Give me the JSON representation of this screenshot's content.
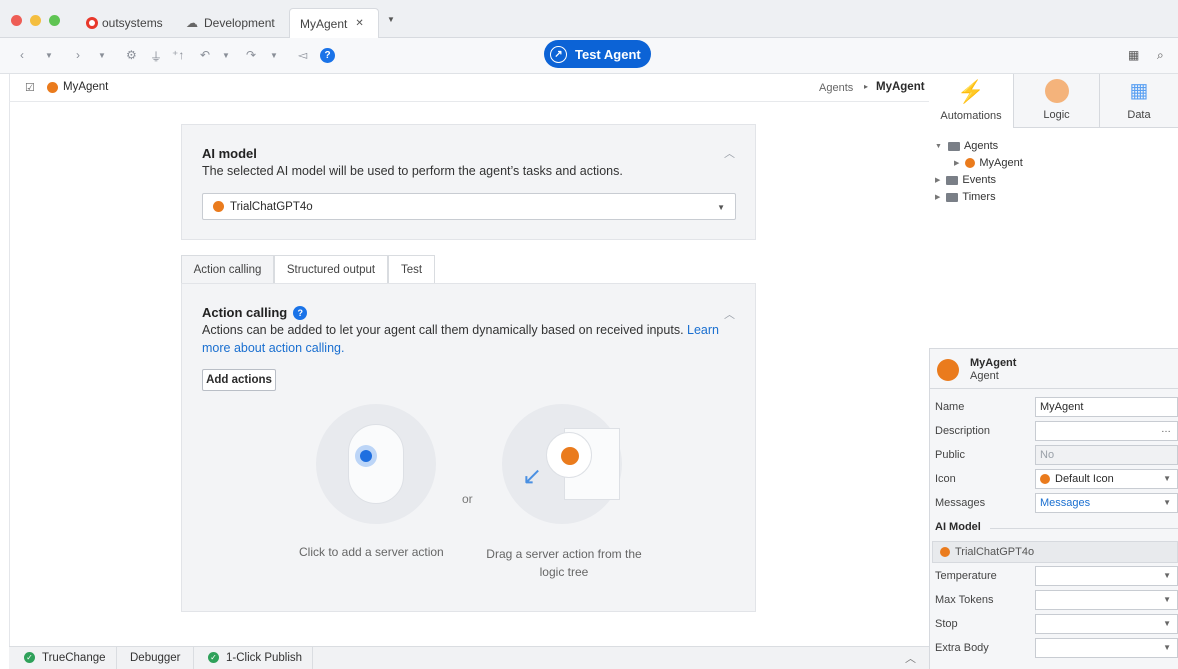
{
  "window": {
    "brand": "outsystems",
    "tabs": [
      {
        "label": "Development"
      },
      {
        "label": "MyAgent",
        "close": "✕"
      }
    ]
  },
  "toolbar": {
    "test_agent_label": "Test Agent"
  },
  "breadcrumb": {
    "element_name": "MyAgent",
    "path_parent": "Agents",
    "path_separator": "▸",
    "path_current": "MyAgent"
  },
  "ai_model_card": {
    "title": "AI model",
    "description": "The selected AI model will be used to perform the agent’s tasks and actions.",
    "selected_model": "TrialChatGPT4o"
  },
  "subtabs": [
    "Action calling",
    "Structured output",
    "Test"
  ],
  "action_calling": {
    "title": "Action calling",
    "description_part1": "Actions can be added to let your agent call them dynamically based on received inputs. ",
    "learn_more_link": "Learn more about action calling.",
    "add_button": "Add actions",
    "or_text": "or",
    "option1": "Click to add a server action",
    "option2": "Drag a server action from the logic tree"
  },
  "right_tabs": [
    {
      "label": "Automations",
      "icon": "lightning-icon"
    },
    {
      "label": "Logic",
      "icon": "logic-icon"
    },
    {
      "label": "Data",
      "icon": "data-grid-icon"
    }
  ],
  "tree": [
    {
      "label": "Agents"
    },
    {
      "label": "MyAgent"
    },
    {
      "label": "Events"
    },
    {
      "label": "Timers"
    }
  ],
  "properties": {
    "header_name": "MyAgent",
    "header_type": "Agent",
    "rows": [
      {
        "label": "Name",
        "value": "MyAgent"
      },
      {
        "label": "Description",
        "value": "",
        "trailing": "…"
      },
      {
        "label": "Public",
        "value": "No"
      },
      {
        "label": "Icon",
        "value": "Default Icon"
      },
      {
        "label": "Messages",
        "value": "Messages"
      }
    ],
    "section": "AI Model",
    "model_value": "TrialChatGPT4o",
    "rows2": [
      {
        "label": "Temperature",
        "value": ""
      },
      {
        "label": "Max Tokens",
        "value": ""
      },
      {
        "label": "Stop",
        "value": ""
      },
      {
        "label": "Extra Body",
        "value": ""
      }
    ]
  },
  "statusbar": {
    "truechange": "TrueChange",
    "debugger": "Debugger",
    "publish": "1-Click Publish"
  },
  "colors": {
    "accent": "#0c63d6",
    "brand_red": "#e8382b",
    "model_orange": "#ea7b1d",
    "success": "#2fa15a"
  }
}
